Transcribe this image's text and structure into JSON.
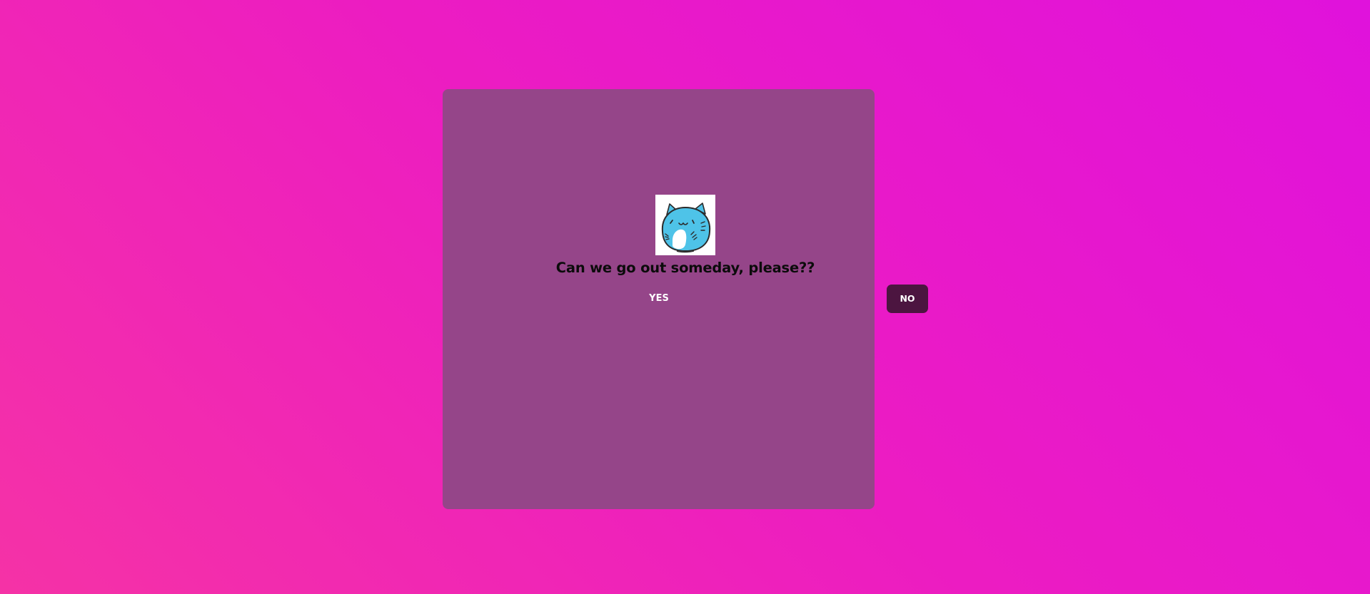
{
  "prompt": {
    "question": "Can we go out someday, please??"
  },
  "buttons": {
    "yes_label": "YES",
    "no_label": "NO"
  },
  "mascot": {
    "icon": "blue-cat-mascot-icon"
  },
  "colors": {
    "background_start": "#e012dc",
    "background_end": "#f532a6",
    "card": "#954589",
    "no_button": "#4c1540",
    "mascot_body": "#4ec3e8"
  }
}
